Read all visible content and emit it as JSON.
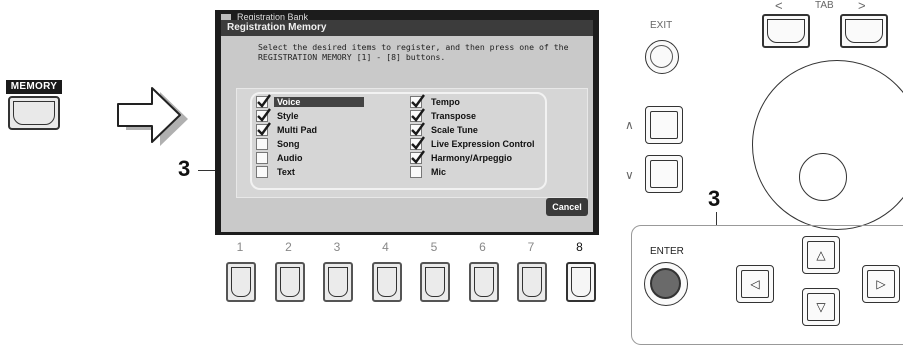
{
  "memory_button": {
    "label": "MEMORY"
  },
  "screen": {
    "title_bar": "Registration Bank",
    "dialog_title": "Registration Memory",
    "instruction_line1": "Select the desired items to register, and then press one of the",
    "instruction_line2": "REGISTRATION MEMORY [1] - [8] buttons.",
    "options_left": [
      {
        "label": "Voice",
        "checked": true,
        "selected": true
      },
      {
        "label": "Style",
        "checked": true
      },
      {
        "label": "Multi Pad",
        "checked": true
      },
      {
        "label": "Song",
        "checked": false
      },
      {
        "label": "Audio",
        "checked": false
      },
      {
        "label": "Text",
        "checked": false
      }
    ],
    "options_right": [
      {
        "label": "Tempo",
        "checked": true
      },
      {
        "label": "Transpose",
        "checked": true
      },
      {
        "label": "Scale Tune",
        "checked": true
      },
      {
        "label": "Live Expression Control",
        "checked": true
      },
      {
        "label": "Harmony/Arpeggio",
        "checked": true
      },
      {
        "label": "Mic",
        "checked": false
      }
    ],
    "cancel_label": "Cancel"
  },
  "registration_buttons": [
    "1",
    "2",
    "3",
    "4",
    "5",
    "6",
    "7",
    "8"
  ],
  "active_registration": "8",
  "callouts": {
    "left": "3",
    "right": "3"
  },
  "right_panel": {
    "exit_label": "EXIT",
    "tab_label": "TAB",
    "tab_left": "<",
    "tab_right": ">",
    "up_label": "∧",
    "down_label": "∨",
    "enter_label": "ENTER",
    "dpad": {
      "up": "△",
      "down": "▽",
      "left": "◁",
      "right": "▷"
    }
  }
}
